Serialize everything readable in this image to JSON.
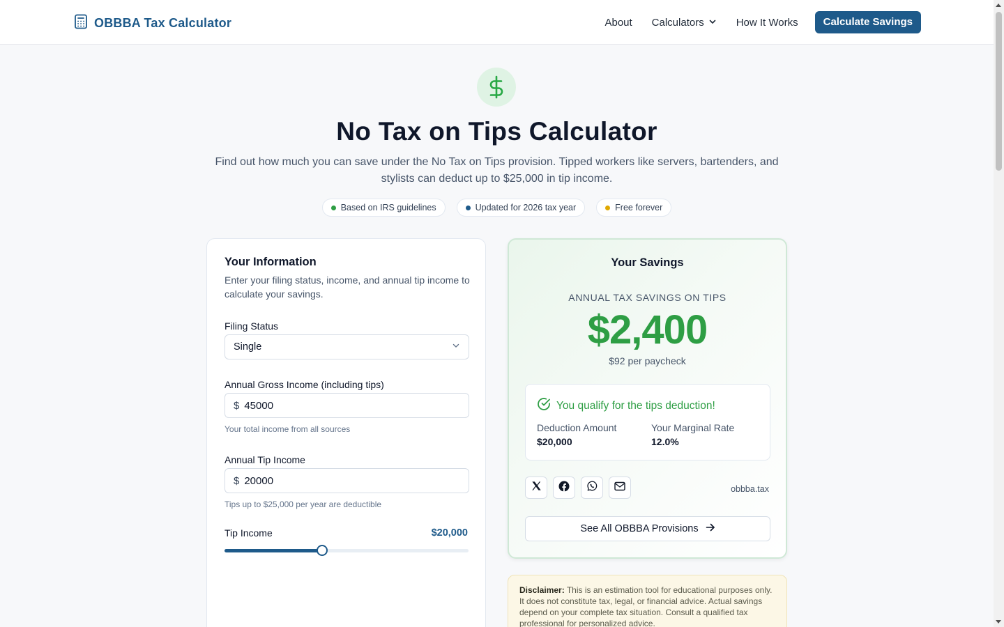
{
  "header": {
    "brand_title": "OBBBA Tax Calculator",
    "nav": {
      "about": "About",
      "calculators": "Calculators",
      "how_it_works": "How It Works",
      "cta": "Calculate Savings"
    }
  },
  "hero": {
    "icon": "dollar-icon",
    "title": "No Tax on Tips Calculator",
    "subtitle": "Find out how much you can save under the No Tax on Tips provision. Tipped workers like servers, bartenders, and stylists can deduct up to $25,000 in tip income.",
    "badges": [
      {
        "label": "Based on IRS guidelines",
        "color": "#2e9e44"
      },
      {
        "label": "Updated for 2026 tax year",
        "color": "#1e5a8a"
      },
      {
        "label": "Free forever",
        "color": "#e0a800"
      }
    ]
  },
  "form": {
    "title": "Your Information",
    "description": "Enter your filing status, income, and annual tip income to calculate your savings.",
    "filing_status": {
      "label": "Filing Status",
      "value": "Single"
    },
    "gross_income": {
      "label": "Annual Gross Income (including tips)",
      "prefix": "$",
      "value": "45000",
      "helper": "Your total income from all sources"
    },
    "tip_income": {
      "label": "Annual Tip Income",
      "prefix": "$",
      "value": "20000",
      "helper": "Tips up to $25,000 per year are deductible"
    },
    "slider": {
      "label": "Tip Income",
      "display_value": "$20,000",
      "fill_fraction": 0.4
    }
  },
  "results": {
    "title": "Your Savings",
    "caption": "ANNUAL TAX SAVINGS ON TIPS",
    "amount": "$2,400",
    "per_paycheck": "$92 per paycheck",
    "qualify": {
      "message": "You qualify for the tips deduction!",
      "deduction_label": "Deduction Amount",
      "deduction_value": "$20,000",
      "rate_label": "Your Marginal Rate",
      "rate_value": "12.0%"
    },
    "share": {
      "icons": [
        "x-icon",
        "facebook-icon",
        "whatsapp-icon",
        "mail-icon"
      ],
      "domain": "obbba.tax"
    },
    "provisions_button": "See All OBBBA Provisions"
  },
  "disclaimer": {
    "label": "Disclaimer:",
    "text": "This is an estimation tool for educational purposes only. It does not constitute tax, legal, or financial advice. Actual savings depend on your complete tax situation. Consult a qualified tax professional for personalized advice."
  },
  "colors": {
    "brand": "#1e5a8a",
    "success": "#2e9e44",
    "page_bg": "#f7f8fa"
  }
}
